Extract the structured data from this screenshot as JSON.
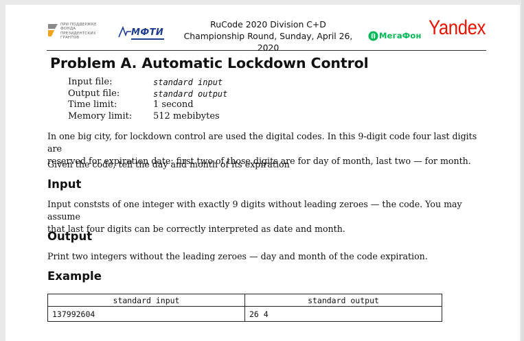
{
  "header": {
    "fpg_logo_lines": [
      "При поддержке",
      "фонда",
      "президентских",
      "грантов"
    ],
    "mfti_logo_text": "МФТИ",
    "contest_line1": "RuCode 2020 Division C+D",
    "contest_line2": "Championship Round, Sunday, April 26, 2020",
    "megafon_logo_text": "МегаФон",
    "yandex_logo_text": "Yandex"
  },
  "problem": {
    "title": "Problem A. Automatic Lockdown Control",
    "meta": [
      {
        "label": "Input file:",
        "value": "standard input",
        "mono": true
      },
      {
        "label": "Output file:",
        "value": "standard output",
        "mono": true
      },
      {
        "label": "Time limit:",
        "value": "1 second",
        "mono": false
      },
      {
        "label": "Memory limit:",
        "value": "512 mebibytes",
        "mono": false
      }
    ],
    "legend_p1_line1": "In one big city, for lockdown control are used the digital codes. In this 9-digit code four last digits are",
    "legend_p1_line2": "reserved for expiration date: first two of those digits are for day of month, last two — for month.",
    "legend_p2": "Given the code, tell the day and month of its expiration",
    "input_heading": "Input",
    "input_line1": "Input conststs of one integer with exactly 9 digits without leading zeroes — the code. You may assume",
    "input_line2": "that last four digits can be correctly interpreted as date and month.",
    "output_heading": "Output",
    "output_text": "Print two integers without the leading zeroes — day and month of the code expiration.",
    "example_heading": "Example",
    "example": {
      "col_input": "standard input",
      "col_output": "standard output",
      "rows": [
        {
          "input": "137992604",
          "output": "26 4"
        }
      ]
    }
  },
  "colors": {
    "mfti_blue": "#1d3b8f",
    "megafon_green": "#00b956",
    "yandex_red": "#e61400"
  }
}
